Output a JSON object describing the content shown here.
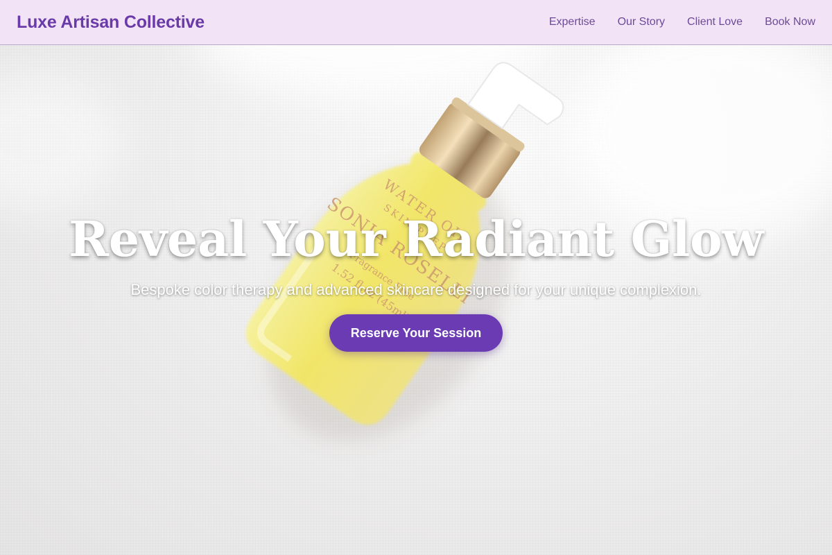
{
  "header": {
    "brand": "Luxe Artisan Collective",
    "nav": [
      {
        "label": "Expertise"
      },
      {
        "label": "Our Story"
      },
      {
        "label": "Client Love"
      },
      {
        "label": "Book Now"
      }
    ]
  },
  "hero": {
    "headline": "Reveal Your Radiant Glow",
    "subheadline": "Bespoke color therapy and advanced skincare designed for your unique complexion.",
    "cta_label": "Reserve Your Session",
    "product_label": {
      "line1": "WATER OIL",
      "line2": "SKIN PREP",
      "line3": "SONIA ROSELLI",
      "line4": "Fragrance Free",
      "line5": "1.52 fl.oz (45ml)"
    }
  },
  "colors": {
    "header_bg": "#f2e4f6",
    "brand": "#6a3aa9",
    "nav_text": "#6d4a99",
    "cta_bg": "#6a3bb3"
  }
}
